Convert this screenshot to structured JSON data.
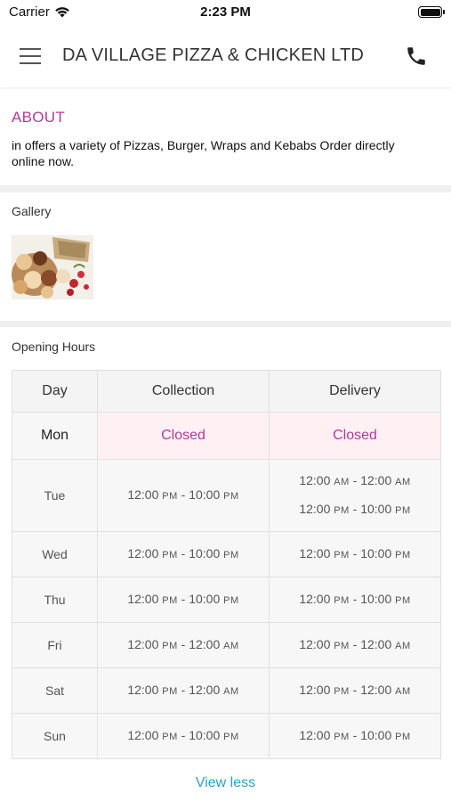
{
  "status": {
    "carrier": "Carrier",
    "time": "2:23 PM"
  },
  "header": {
    "title": "DA VILLAGE PIZZA & CHICKEN LTD"
  },
  "about": {
    "title": "ABOUT",
    "text": "in  offers a variety of Pizzas, Burger, Wraps and Kebabs Order directly online now."
  },
  "gallery": {
    "label": "Gallery"
  },
  "hours": {
    "label": "Opening Hours",
    "columns": [
      "Day",
      "Collection",
      "Delivery"
    ],
    "rows": [
      {
        "day": "Mon",
        "closed": true,
        "collection": "Closed",
        "delivery": "Closed"
      },
      {
        "day": "Tue",
        "collection": [
          [
            "12:00",
            "PM",
            "10:00",
            "PM"
          ]
        ],
        "delivery": [
          [
            "12:00",
            "AM",
            "12:00",
            "AM"
          ],
          [
            "12:00",
            "PM",
            "10:00",
            "PM"
          ]
        ]
      },
      {
        "day": "Wed",
        "collection": [
          [
            "12:00",
            "PM",
            "10:00",
            "PM"
          ]
        ],
        "delivery": [
          [
            "12:00",
            "PM",
            "10:00",
            "PM"
          ]
        ]
      },
      {
        "day": "Thu",
        "collection": [
          [
            "12:00",
            "PM",
            "10:00",
            "PM"
          ]
        ],
        "delivery": [
          [
            "12:00",
            "PM",
            "10:00",
            "PM"
          ]
        ]
      },
      {
        "day": "Fri",
        "collection": [
          [
            "12:00",
            "PM",
            "12:00",
            "AM"
          ]
        ],
        "delivery": [
          [
            "12:00",
            "PM",
            "12:00",
            "AM"
          ]
        ]
      },
      {
        "day": "Sat",
        "collection": [
          [
            "12:00",
            "PM",
            "12:00",
            "AM"
          ]
        ],
        "delivery": [
          [
            "12:00",
            "PM",
            "12:00",
            "AM"
          ]
        ]
      },
      {
        "day": "Sun",
        "collection": [
          [
            "12:00",
            "PM",
            "10:00",
            "PM"
          ]
        ],
        "delivery": [
          [
            "12:00",
            "PM",
            "10:00",
            "PM"
          ]
        ]
      }
    ]
  },
  "footer": {
    "view_less": "View less"
  },
  "colors": {
    "accent": "#b3399c",
    "link": "#2aa0c6",
    "closed_bg": "#fff0f3"
  },
  "icons": {
    "menu": "hamburger-menu-icon",
    "phone": "phone-icon",
    "wifi": "wifi-icon",
    "battery": "battery-icon"
  }
}
